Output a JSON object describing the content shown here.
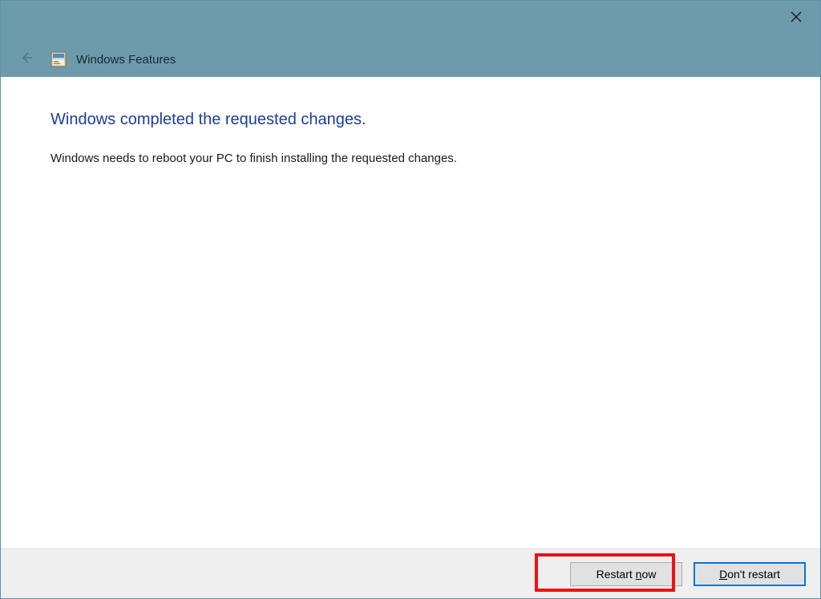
{
  "header": {
    "app_title": "Windows Features"
  },
  "content": {
    "heading": "Windows completed the requested changes.",
    "body": "Windows needs to reboot your PC to finish installing the requested changes."
  },
  "footer": {
    "restart_pre": "Restart ",
    "restart_u": "n",
    "restart_post": "ow",
    "dont_pre": "",
    "dont_u": "D",
    "dont_post": "on't restart"
  },
  "icons": {
    "close": "close-icon",
    "back": "back-arrow-icon",
    "app": "windows-features-icon"
  },
  "highlight": {
    "target": "restart-now-button"
  }
}
